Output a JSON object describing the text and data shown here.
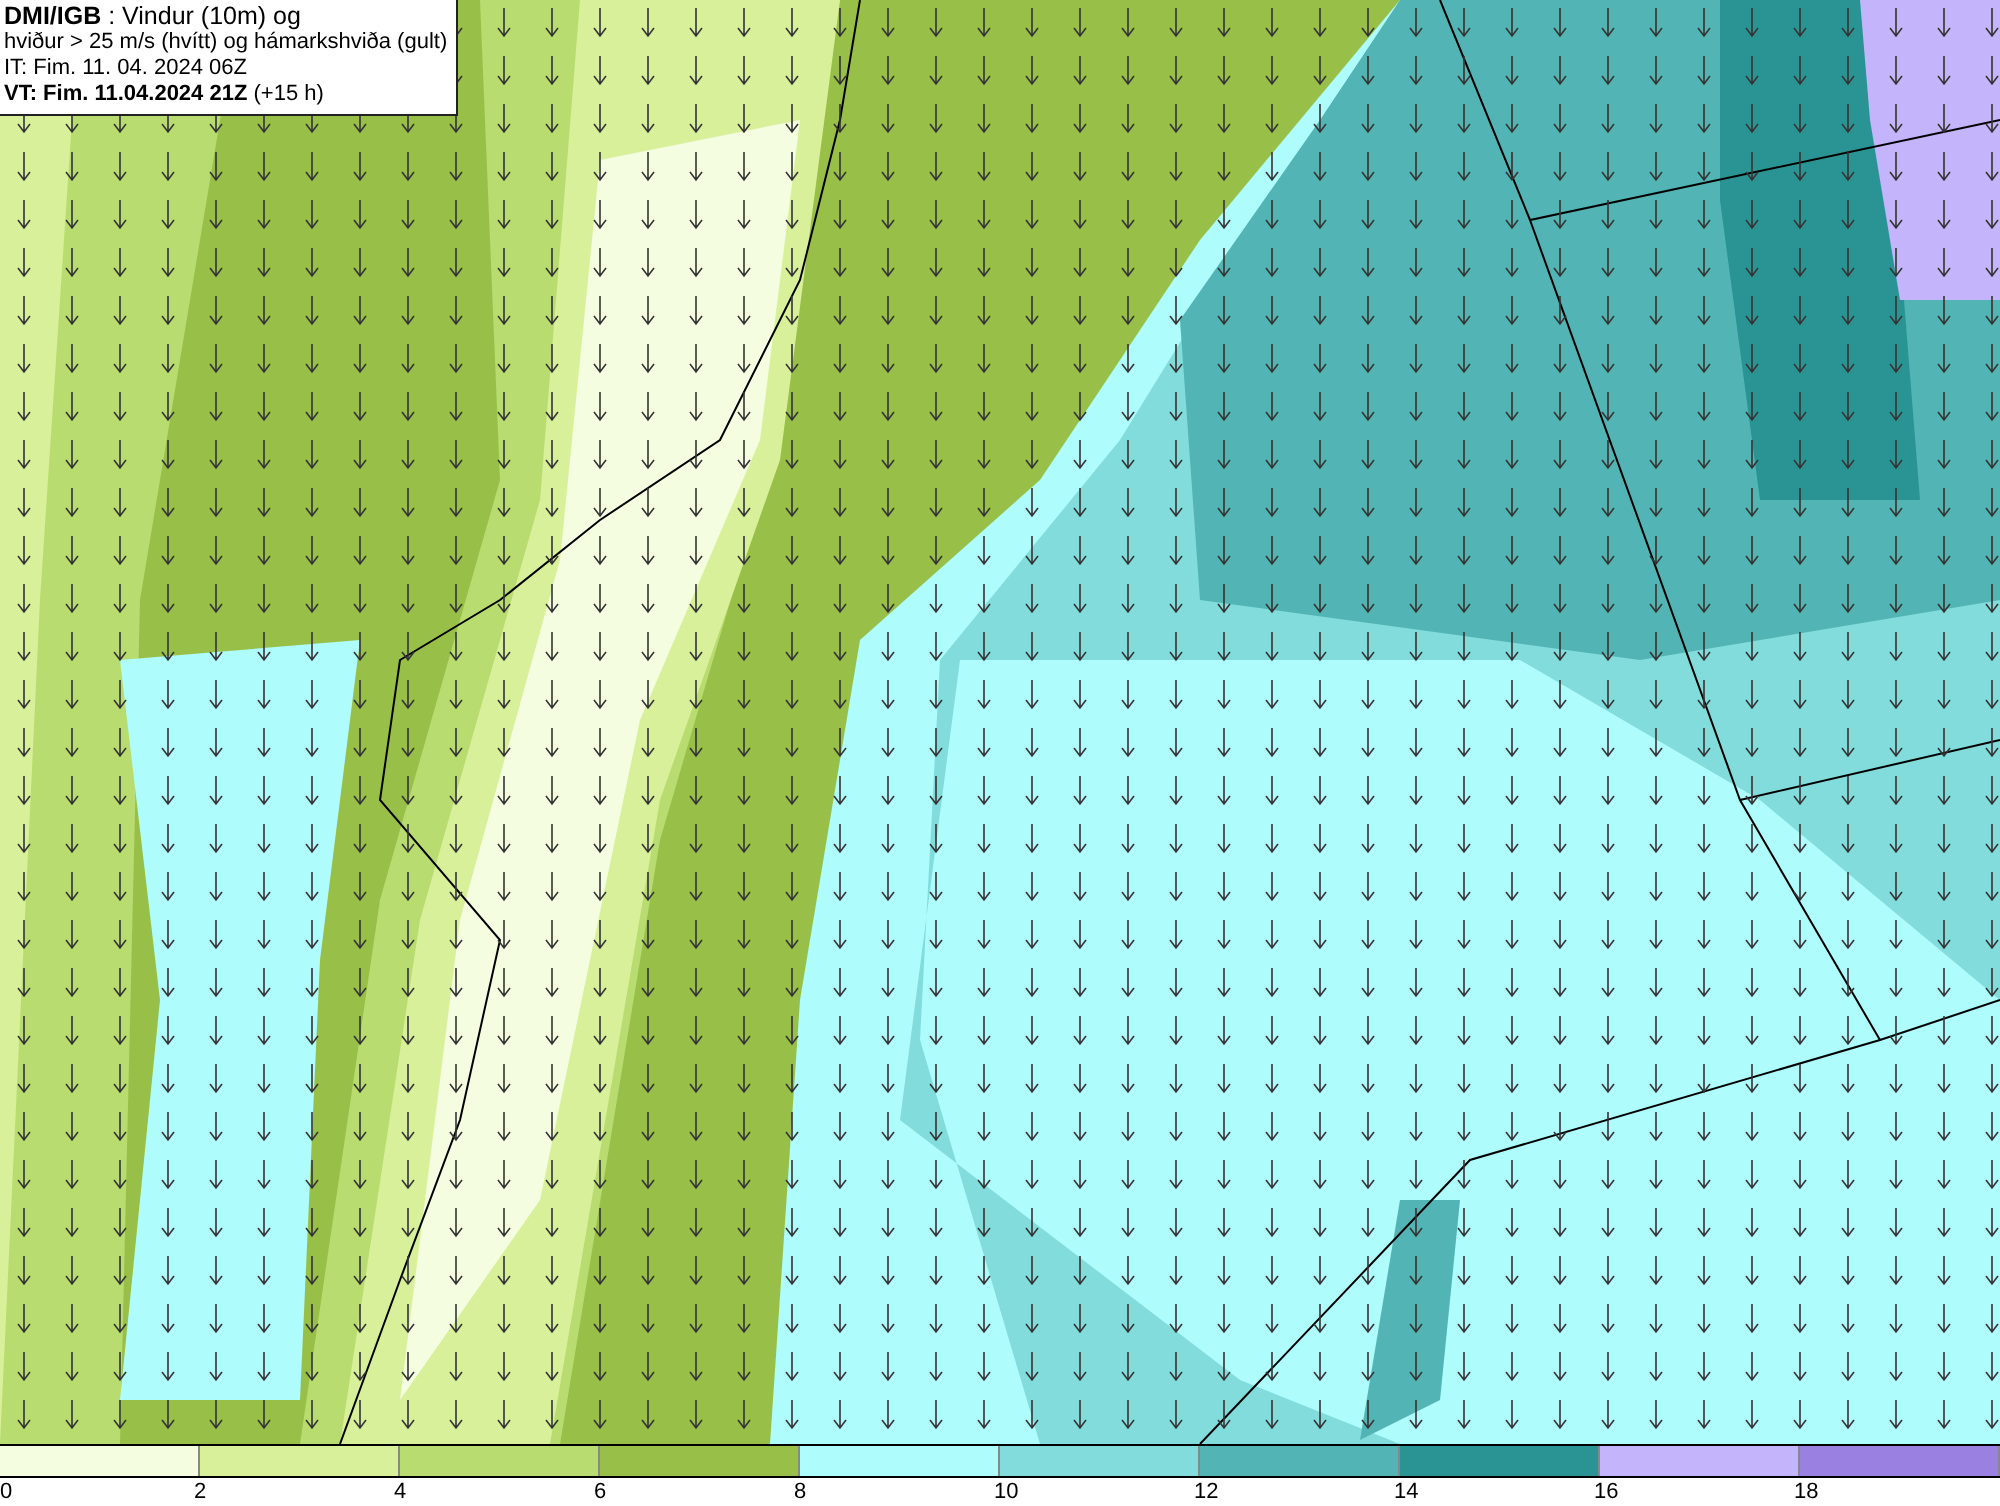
{
  "legend": {
    "lines": [
      "**DMI/IGB** : Vindur (10m) og",
      "hviður > 25 m/s (hvítt) og hámarkshviða (gult)",
      "IT: Fim. 11. 04. 2024 06Z",
      "**VT: Fim. 11.04.2024 21Z** (+15 h)"
    ]
  },
  "colorbar": [
    {
      "label": "0",
      "color": "#f4fde0"
    },
    {
      "label": "2",
      "color": "#d8f09a"
    },
    {
      "label": "4",
      "color": "#b8dc70"
    },
    {
      "label": "6",
      "color": "#98c048"
    },
    {
      "label": "8",
      "color": "#aefcfc"
    },
    {
      "label": "10",
      "color": "#82dcdc"
    },
    {
      "label": "12",
      "color": "#52b4b4"
    },
    {
      "label": "14",
      "color": "#2a9494"
    },
    {
      "label": "16",
      "color": "#c4b4fc"
    },
    {
      "label": "18",
      "color": "#9a80e0"
    }
  ]
}
